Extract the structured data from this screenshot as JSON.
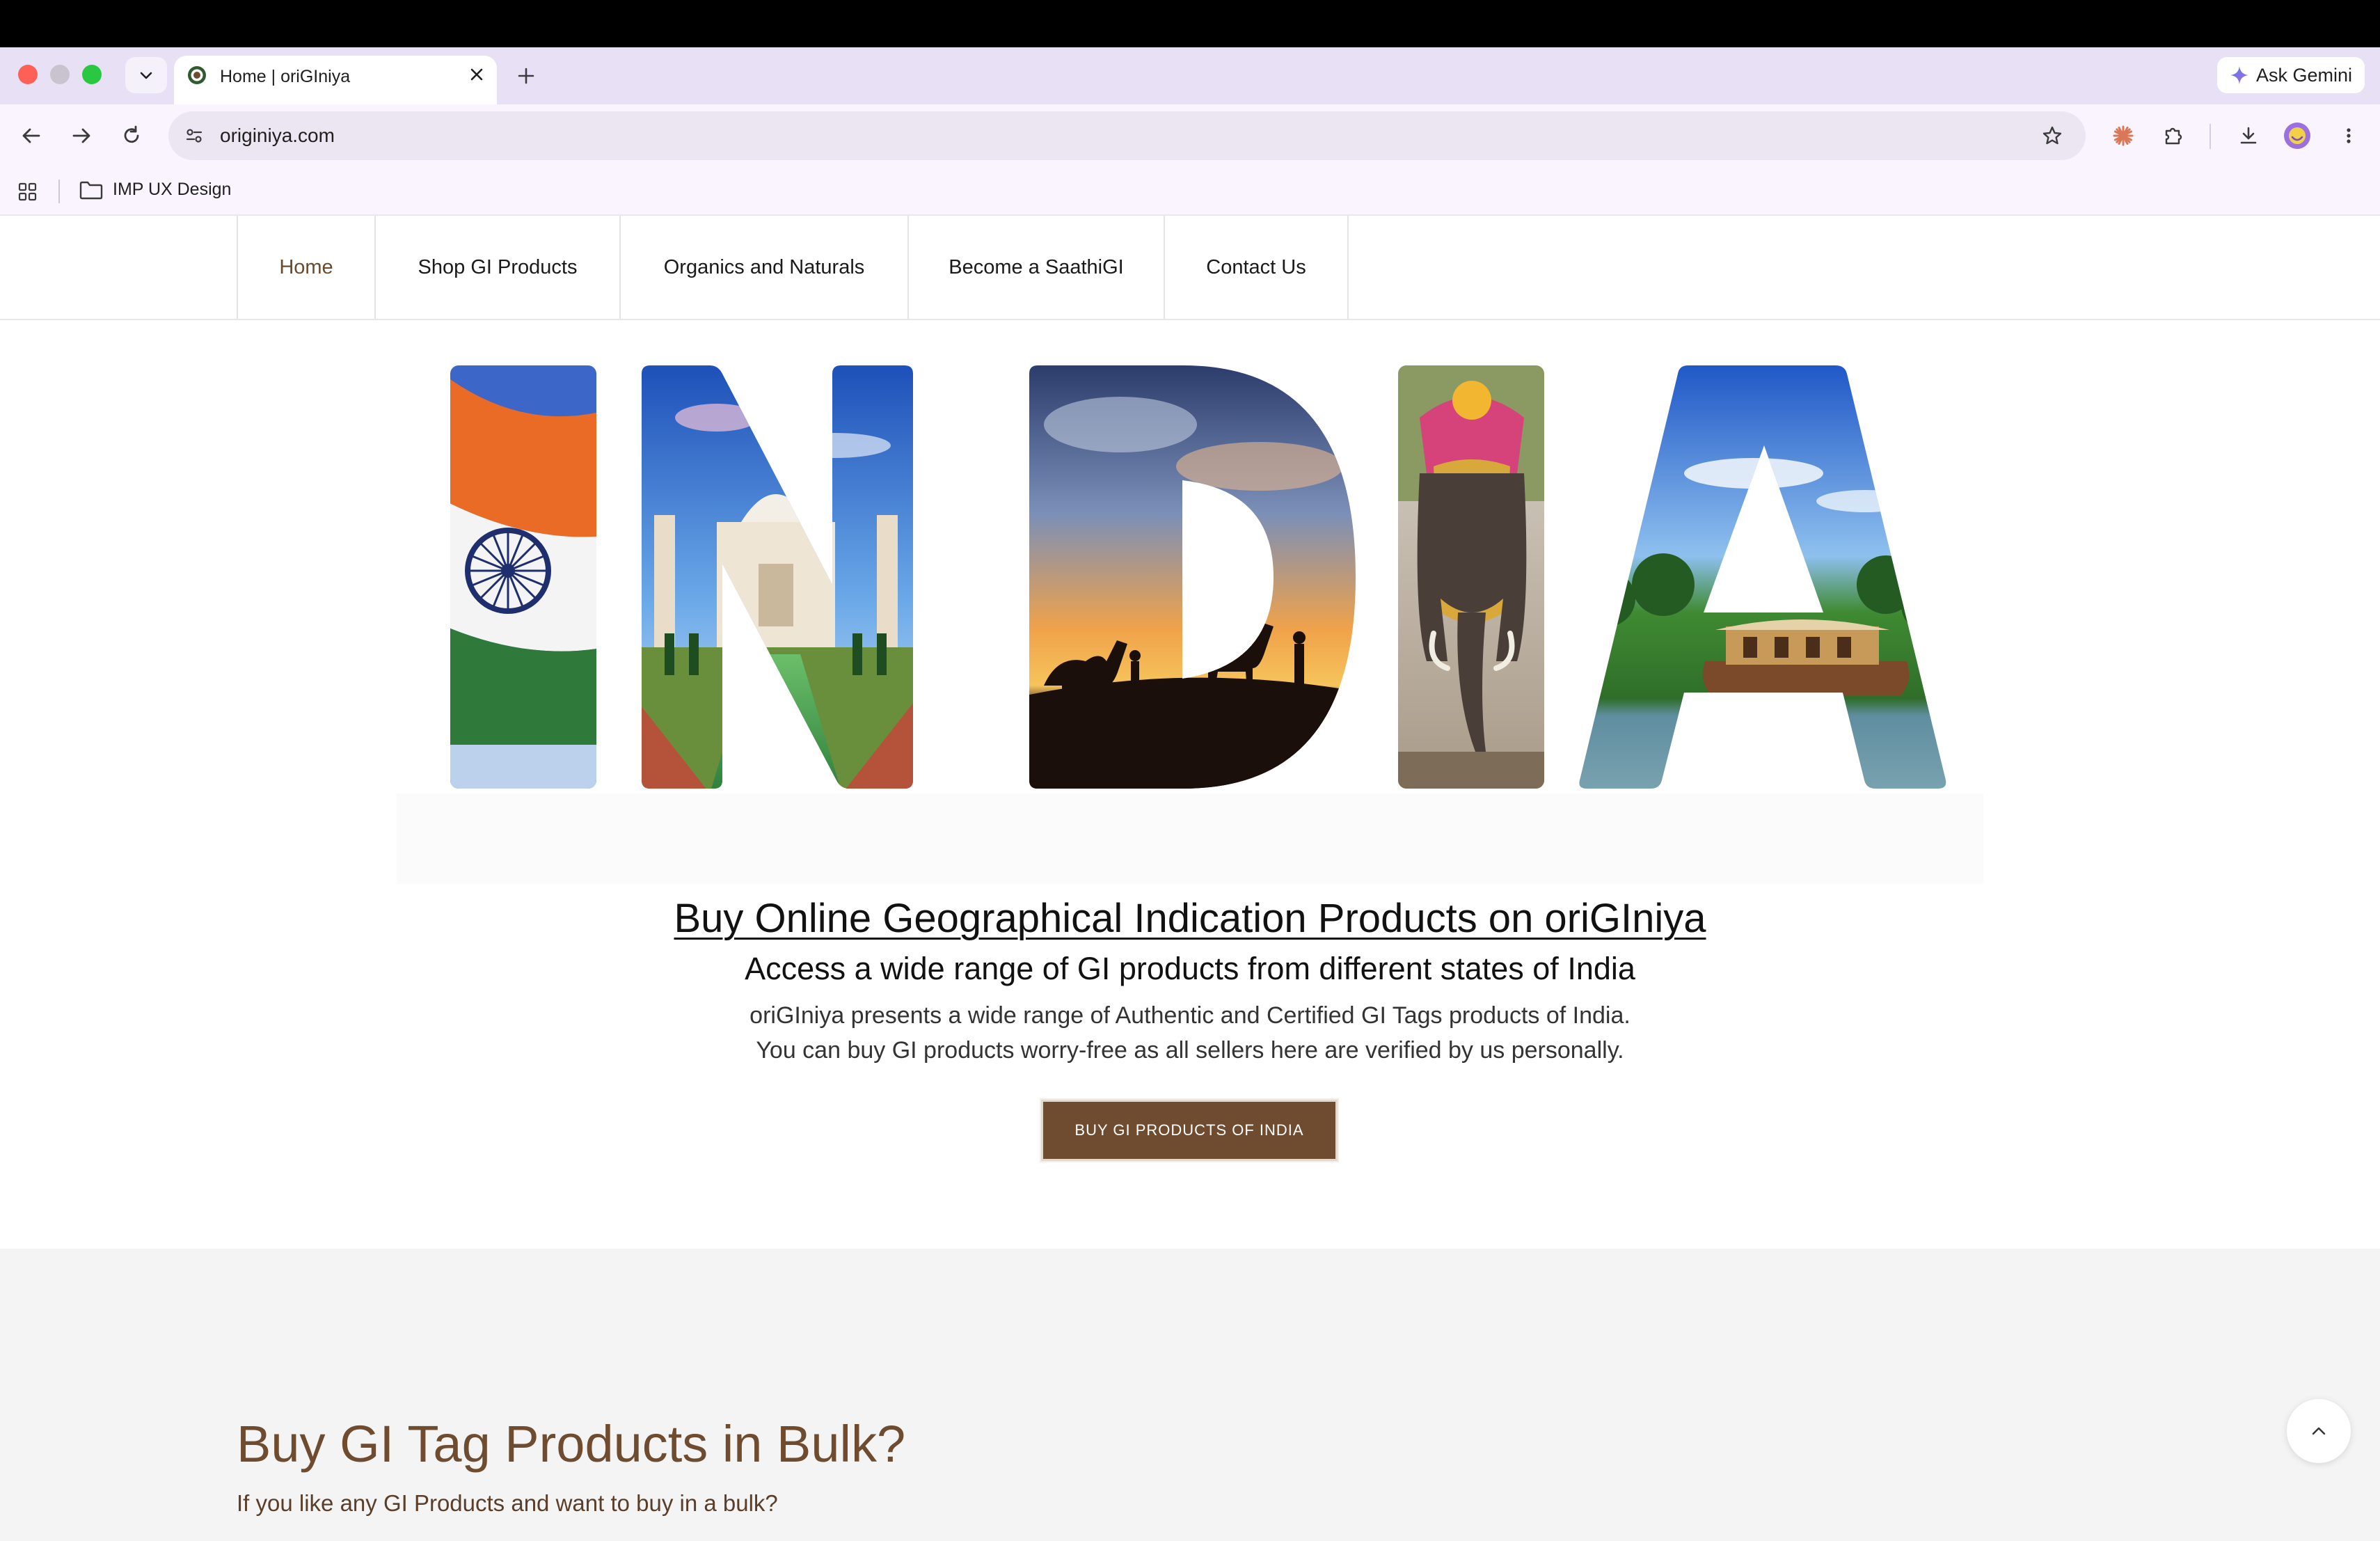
{
  "browser": {
    "tab": {
      "title": "Home | oriGIniya"
    },
    "gemini_label": "Ask Gemini",
    "url": "originiya.com",
    "bookmark_folder": "IMP UX Design"
  },
  "nav": {
    "items": [
      "Home",
      "Shop GI Products",
      "Organics and Naturals",
      "Become a SaathiGI",
      "Contact Us"
    ],
    "active": "Home"
  },
  "hero": {
    "banner_text": "INDIA",
    "heading": "Buy Online Geographical Indication Products on oriGIniya",
    "subheading": "Access a wide range of GI products from different states of India",
    "paragraph_line1": "oriGIniya presents a wide range of Authentic and Certified GI Tags products of India.",
    "paragraph_line2": "You can buy GI products worry-free as all sellers here are verified by us personally.",
    "cta_label": "BUY GI PRODUCTS OF INDIA"
  },
  "bulk": {
    "title": "Buy GI Tag Products in Bulk?",
    "text": "If you like any GI Products and want to buy in a bulk?"
  },
  "colors": {
    "brand_brown": "#6f4b2f",
    "tab_strip": "#e8e0f4",
    "section_bg": "#f4f4f4"
  }
}
